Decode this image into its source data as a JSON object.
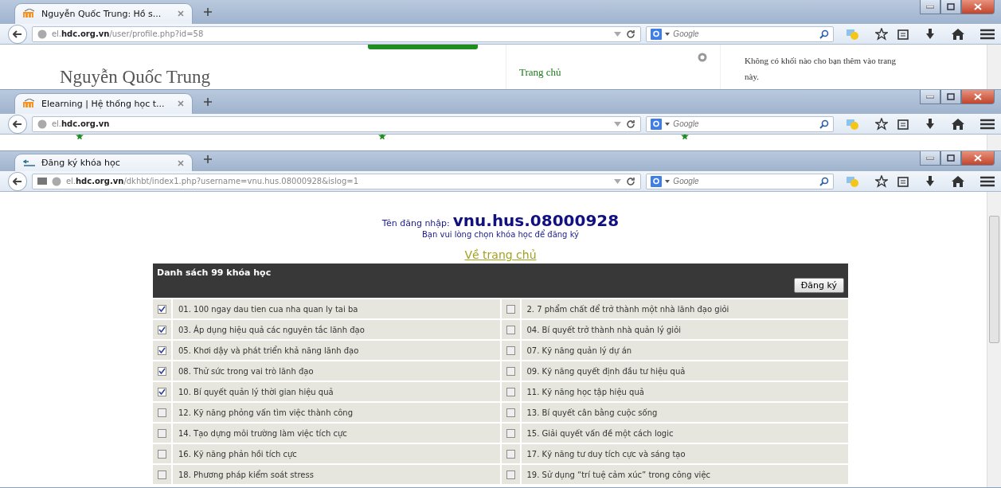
{
  "windows": [
    {
      "tab": {
        "title": "Nguyễn Quốc Trung: Hồ s..."
      },
      "url": "el.**hdc.org.vn**/user/profile.php?id=58",
      "search": {
        "placeholder": "Google"
      },
      "page": {
        "kind": "profile",
        "heading": "Nguyễn Quốc Trung",
        "nav_link": "Trang chủ",
        "block_text": "Không có khối nào cho bạn thêm vào trang này."
      }
    },
    {
      "tab": {
        "title": "Elearning | Hệ thống học t..."
      },
      "url": "el.**hdc.org.vn**",
      "search": {
        "placeholder": "Google"
      },
      "page": {
        "kind": "home"
      }
    },
    {
      "tab": {
        "title": "Đăng ký khóa học"
      },
      "url": "el.**hdc.org.vn**/dkhbt/index1.php?username=vnu.hus.08000928&islog=1",
      "search": {
        "placeholder": "Google"
      },
      "page": {
        "kind": "register",
        "login_label": "Tên đăng nhập:",
        "username": "vnu.hus.08000928",
        "instruction": "Bạn vui lòng chọn khóa học để đăng ký",
        "home_link": "Về trang chủ",
        "table_title": "Danh sách 99 khóa học",
        "submit_button": "Đăng ký",
        "courses": [
          [
            {
              "label": "01. 100 ngay dau tien cua nha quan ly tai ba",
              "checked": true
            },
            {
              "label": "2. 7 phẩm chất để trở thành một nhà lãnh đạo giỏi",
              "checked": false
            }
          ],
          [
            {
              "label": "03. Áp dụng hiệu quả các nguyên tắc lãnh đạo",
              "checked": true
            },
            {
              "label": "04. Bí quyết trở thành nhà quản lý giỏi",
              "checked": false
            }
          ],
          [
            {
              "label": "05. Khơi dậy và phát triển khả năng lãnh đạo",
              "checked": true
            },
            {
              "label": "07. Kỹ năng quản lý dự án",
              "checked": false
            }
          ],
          [
            {
              "label": "08. Thử sức trong vai trò lãnh đạo",
              "checked": true
            },
            {
              "label": "09. Kỹ năng quyết định đầu tư hiệu quả",
              "checked": false
            }
          ],
          [
            {
              "label": "10. Bí quyết quản lý thời gian hiệu quả",
              "checked": true
            },
            {
              "label": "11. Kỹ năng học tập hiệu quả",
              "checked": false
            }
          ],
          [
            {
              "label": "12. Kỹ năng phỏng vấn tìm việc thành công",
              "checked": false
            },
            {
              "label": "13. Bí quyết cân bằng cuộc sống",
              "checked": false
            }
          ],
          [
            {
              "label": "14. Tạo dựng môi trường làm việc tích cực",
              "checked": false
            },
            {
              "label": "15. Giải quyết vấn đề một cách logic",
              "checked": false
            }
          ],
          [
            {
              "label": "16. Kỹ năng phản hồi tích cực",
              "checked": false
            },
            {
              "label": "17. Kỹ năng tư duy tích cực và sáng tạo",
              "checked": false
            }
          ],
          [
            {
              "label": "18. Phương pháp kiểm soát stress",
              "checked": false
            },
            {
              "label": "19. Sử dụng “trí tuệ cảm xúc” trong công việc",
              "checked": false
            }
          ]
        ]
      }
    }
  ]
}
